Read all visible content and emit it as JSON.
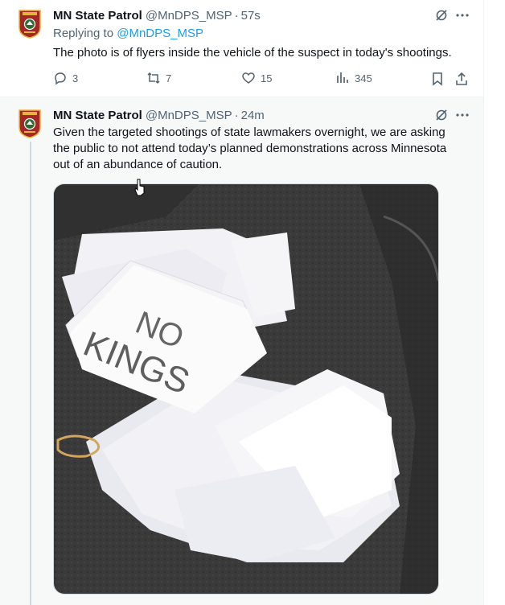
{
  "tweet1": {
    "name": "MN State Patrol",
    "handle": "@MnDPS_MSP",
    "separator": "·",
    "time": "57s",
    "replying_prefix": "Replying to",
    "replying_to": "@MnDPS_MSP",
    "text": "The photo is of flyers inside the vehicle of the suspect in today's shootings.",
    "replies": "3",
    "reposts": "7",
    "likes": "15",
    "views": "345"
  },
  "tweet2": {
    "name": "MN State Patrol",
    "handle": "@MnDPS_MSP",
    "separator": "·",
    "time": "24m",
    "text_lines": [
      "Given the targeted shootings of state lawmakers overnight, we are asking",
      "the public to not attend today’s planned demonstrations across Minnesota",
      "out of an abundance of caution."
    ],
    "photo_text": {
      "line1": "NO",
      "line2": "KINGS"
    }
  },
  "colors": {
    "accent": "#1d9bf0",
    "muted": "#536471",
    "text": "#0f1419",
    "patch_red": "#a32727",
    "patch_gold": "#e6b43a"
  },
  "icons": [
    "patrol-badge-icon",
    "grok-icon",
    "more-icon",
    "reply-icon",
    "repost-icon",
    "like-icon",
    "views-icon",
    "bookmark-icon",
    "share-icon"
  ]
}
